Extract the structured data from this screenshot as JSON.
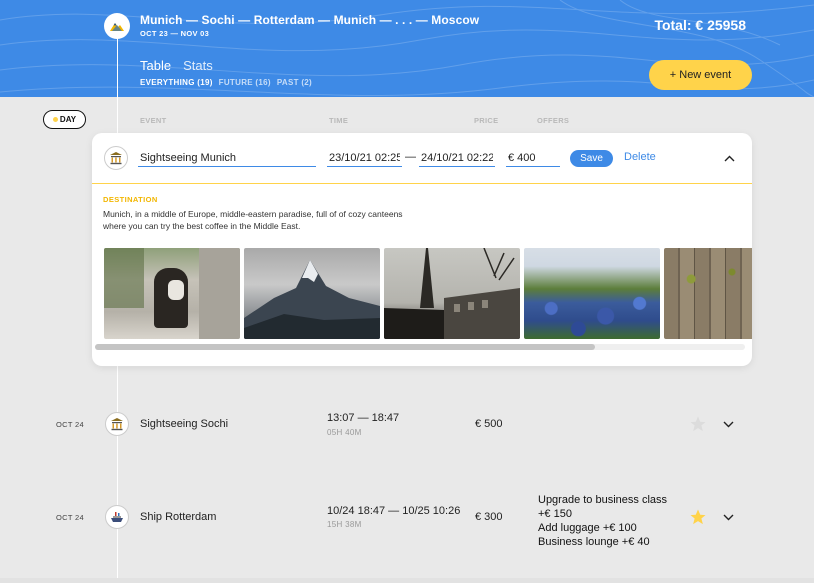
{
  "header": {
    "route": "Munich — Sochi — Rotterdam — Munich — . . . — Moscow",
    "dates": "OCT 23 — NOV 03",
    "total": "Total: € 25958",
    "tabs": [
      {
        "label": "Table"
      },
      {
        "label": "Stats"
      }
    ],
    "filters": [
      {
        "label": "EVERYTHING (19)"
      },
      {
        "label": "FUTURE (16)"
      },
      {
        "label": "PAST (2)"
      }
    ],
    "new_event": "+ New event",
    "logo_icon": "mountains-logo-icon"
  },
  "columns": {
    "sort": "DAY",
    "event": "EVENT",
    "time": "TIME",
    "price": "PRICE",
    "offers": "OFFERS"
  },
  "edit_form": {
    "icon": "landmark-icon",
    "name": "Sightseeing Munich",
    "start": "23/10/21 02:25",
    "end": "24/10/21 02:22",
    "price": "€ 400",
    "save": "Save",
    "delete": "Delete",
    "destination_label": "DESTINATION",
    "destination_text": "Munich, in a middle of Europe, middle-eastern paradise, full of of cozy canteens where you can try the best coffee in the Middle East.",
    "photos": [
      "street-photo",
      "mountain-photo",
      "eiffel-tower-photo",
      "bluebonnet-photo",
      "wood-photo"
    ]
  },
  "events": [
    {
      "date": "OCT 24",
      "icon": "landmark-icon",
      "name": "Sightseeing Sochi",
      "time": "13:07 — 18:47",
      "duration": "05H 40M",
      "price": "€ 500",
      "offers": [],
      "favorite": false
    },
    {
      "date": "OCT 24",
      "icon": "ship-icon",
      "name": "Ship Rotterdam",
      "time": "10/24 18:47 — 10/25 10:26",
      "duration": "15H 38M",
      "price": "€ 300",
      "offers": [
        {
          "text": "Upgrade to business class +€  150"
        },
        {
          "text": "Add luggage +€  100"
        },
        {
          "text": "Business lounge +€  40"
        }
      ],
      "favorite": true
    }
  ],
  "colors": {
    "brand_blue": "#3e8ae6",
    "accent_yellow": "#ffd34a",
    "background": "#e9e9e9"
  }
}
